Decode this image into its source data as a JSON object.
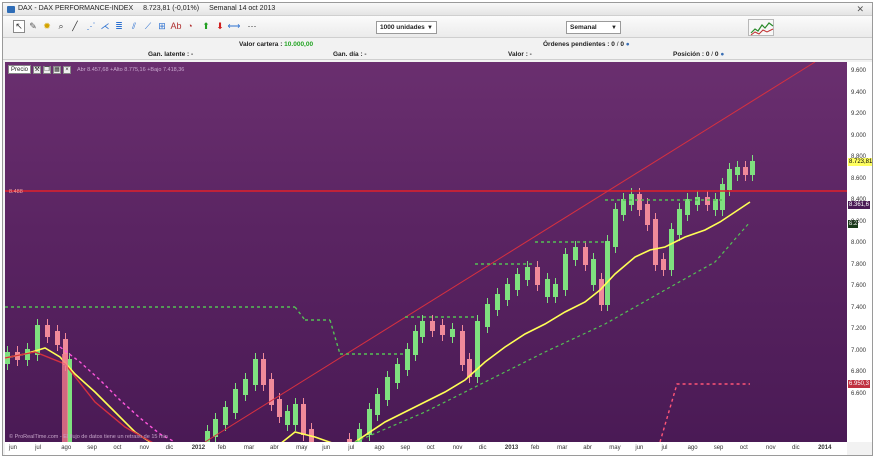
{
  "window": {
    "instrument": "DAX - DAX PERFORMANCE-INDEX",
    "last_price": "8.723,81 (-0,01%)",
    "period_label": "Semanal",
    "date": "14 oct 2013",
    "close_glyph": "✕"
  },
  "toolbar": {
    "tools": [
      {
        "name": "pointer-tool-icon",
        "glyph": "↖",
        "color": "#333333"
      },
      {
        "name": "pencil-tool-icon",
        "glyph": "✎",
        "color": "#555555"
      },
      {
        "name": "bell-alert-icon",
        "glyph": "✹",
        "color": "#d4a400"
      },
      {
        "name": "zoom-icon",
        "glyph": "⌕",
        "color": "#333333"
      },
      {
        "name": "trendline-icon",
        "glyph": "╱",
        "color": "#333333"
      },
      {
        "name": "fan-line-icon",
        "glyph": "⋰",
        "color": "#2a6fd0"
      },
      {
        "name": "pitchfork-icon",
        "glyph": "⋌",
        "color": "#2a6fd0"
      },
      {
        "name": "fibonacci-icon",
        "glyph": "≣",
        "color": "#2a6fd0"
      },
      {
        "name": "channel-icon",
        "glyph": "⫽",
        "color": "#2a6fd0"
      },
      {
        "name": "regression-icon",
        "glyph": "⟋",
        "color": "#2a6fd0"
      },
      {
        "name": "gann-icon",
        "glyph": "⊞",
        "color": "#2a6fd0"
      },
      {
        "name": "text-tool-icon",
        "glyph": "Ab",
        "color": "#b03030"
      },
      {
        "name": "marker-icon",
        "glyph": "◔",
        "color": "#b03030"
      },
      {
        "name": "up-arrow-icon",
        "glyph": "⬆",
        "color": "#22a022"
      },
      {
        "name": "down-arrow-icon",
        "glyph": "⬇",
        "color": "#d02020"
      },
      {
        "name": "horizontal-line-icon",
        "glyph": "⟷",
        "color": "#2a6fd0"
      },
      {
        "name": "ellipse-icon",
        "glyph": "⋯",
        "color": "#333333"
      }
    ],
    "quantity_select": "1000 unidades",
    "period_select": "Semanal",
    "dropdown_arrow": "▼"
  },
  "info": {
    "valor_cartera_label": "Valor cartera :",
    "valor_cartera_value": "10.000,00",
    "gan_latente": "Gan. latente : -",
    "gan_dia": "Gan. día : -",
    "valor": "Valor : -",
    "ordenes_pendientes": "Órdenes pendientes : 0",
    "ordenes_count": "0",
    "posicion": "Posición : 0",
    "posicion_count": "0",
    "slash": "/"
  },
  "chart": {
    "panel_name": "Precio",
    "ohlc_text": "Abr 8.457,68 +Alto 8.775,16 +Bajo 7.418,36",
    "level_line_label": "8.488",
    "watermark": "© ProRealTime.com - El flujo de datos tiene un retraso de 15 min",
    "price_labels": [
      "9.600",
      "9.400",
      "9.200",
      "9.000",
      "8.800",
      "8.600",
      "8.400",
      "8.200",
      "8.000",
      "7.800",
      "7.600",
      "7.400",
      "7.200",
      "7.000",
      "6.800",
      "6.600"
    ],
    "time_labels": [
      "jun",
      "jul",
      "ago",
      "sep",
      "oct",
      "nov",
      "dic",
      "2012",
      "feb",
      "mar",
      "abr",
      "may",
      "jun",
      "jul",
      "ago",
      "sep",
      "oct",
      "nov",
      "dic",
      "2013",
      "feb",
      "mar",
      "abr",
      "may",
      "jun",
      "jul",
      "ago",
      "sep",
      "oct",
      "nov",
      "dic",
      "2014"
    ],
    "current_price_tag": "8.723,81",
    "ma_tag": "8.361,6",
    "ma2_tag": "8.2",
    "stop_tag": "6.950,3",
    "colors": {
      "background_top": "#6a2f6f",
      "background_bottom": "#4a1a55",
      "bull_candle": "#7fe07f",
      "bear_candle": "#f08a9a",
      "moving_average": "#ffff55",
      "resistance_line": "#e0202a",
      "trendline": "#d43040",
      "trailing_stop_long": "#55c055",
      "trailing_stop_short": "#ff55dd",
      "fill": "#1f5a1f"
    }
  }
}
